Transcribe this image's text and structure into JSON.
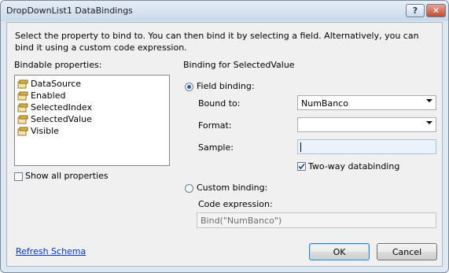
{
  "window": {
    "title": "DropDownList1 DataBindings",
    "help_label": "?",
    "close_label": "✕"
  },
  "description": "Select the property to bind to. You can then bind it by selecting a field. Alternatively, you can bind it using a custom code expression.",
  "left": {
    "heading": "Bindable properties:",
    "properties": [
      "DataSource",
      "Enabled",
      "SelectedIndex",
      "SelectedValue",
      "Visible"
    ],
    "selected": "SelectedValue",
    "show_all_label": "Show all properties",
    "show_all_checked": false
  },
  "right": {
    "heading": "Binding for SelectedValue",
    "field_binding_label": "Field binding:",
    "field_binding_selected": true,
    "bound_to_label": "Bound to:",
    "bound_to_value": "NumBanco",
    "format_label": "Format:",
    "format_value": "",
    "sample_label": "Sample:",
    "sample_value": "",
    "two_way_label": "Two-way databinding",
    "two_way_checked": true,
    "custom_binding_label": "Custom binding:",
    "custom_binding_selected": false,
    "code_expression_label": "Code expression:",
    "code_expression_value": "Bind(\"NumBanco\")"
  },
  "footer": {
    "refresh_label": "Refresh Schema",
    "ok_label": "OK",
    "cancel_label": "Cancel"
  },
  "colors": {
    "title_bar": "#c9d9ea",
    "dialog_bg": "#f0f0f0",
    "link": "#0033cc",
    "close_button": "#c44a33"
  },
  "icons": {
    "property_icon": "property-icon",
    "help": "help-icon",
    "close": "close-icon"
  }
}
